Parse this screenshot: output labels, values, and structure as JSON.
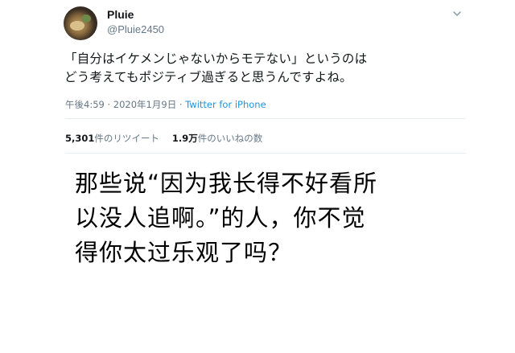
{
  "tweet": {
    "display_name": "Pluie",
    "handle": "@Pluie2450",
    "avatar_icon": "avatar-image",
    "menu_icon": "chevron-down-icon",
    "text": "「自分はイケメンじゃないからモテない」というのは\nどう考えてもポジティブ過ぎると思うんですよね。",
    "timestamp": "午後4:59 · 2020年1月9日 · ",
    "source": "Twitter for iPhone",
    "link_color": "#1b95e0",
    "stats": {
      "retweets_number": "5,301",
      "retweets_label": "件のリツイート",
      "likes_number": "1.9万",
      "likes_label": "件のいいねの数"
    }
  },
  "caption": "那些说“因为我长得不好看所\n以没人追啊。”的人，你不觉\n得你太过乐观了吗？"
}
